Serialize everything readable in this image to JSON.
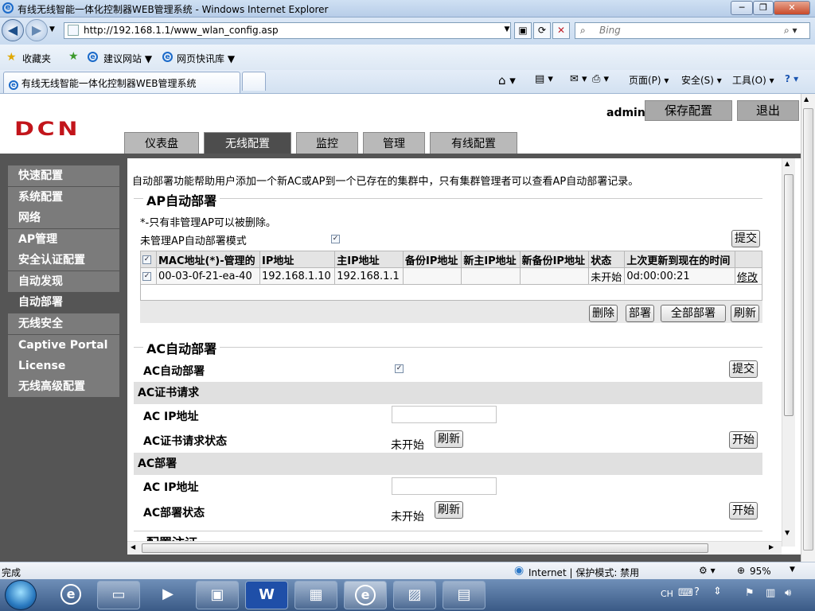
{
  "browser": {
    "window_title": "有线无线智能一体化控制器WEB管理系统 - Windows Internet Explorer",
    "url": "http://192.168.1.1/www_wlan_config.asp",
    "search_placeholder": "Bing",
    "favorites_label": "收藏夹",
    "suggested_sites": "建议网站 ▼",
    "web_slice": "网页快讯库 ▼",
    "tab_title": "有线无线智能一体化控制器WEB管理系统",
    "cmd_page": "页面(P) ▾",
    "cmd_safety": "安全(S) ▾",
    "cmd_tools": "工具(O) ▾",
    "status_text": "完成",
    "zone_text": "Internet | 保护模式: 禁用",
    "zoom": "95%",
    "lang": "CH"
  },
  "header": {
    "logo": "DCN",
    "user": "admin",
    "save_btn": "保存配置",
    "logout_btn": "退出"
  },
  "tabs": [
    "仪表盘",
    "无线配置",
    "监控",
    "管理",
    "有线配置"
  ],
  "sidebar": [
    "快速配置",
    "系统配置",
    "网络",
    "AP管理",
    "安全认证配置",
    "自动发现",
    "自动部署",
    "无线安全",
    "Captive Portal",
    "License",
    "无线高级配置"
  ],
  "content": {
    "intro": "自动部署功能帮助用户添加一个新AC或AP到一个已存在的集群中，只有集群管理者可以查看AP自动部署记录。",
    "ap_section_title": "AP自动部署",
    "note": "*-只有非管理AP可以被删除。",
    "unmanaged_mode_label": "未管理AP自动部署模式",
    "submit": "提交",
    "table_headers": [
      "MAC地址(*)-管理的",
      "IP地址",
      "主IP地址",
      "备份IP地址",
      "新主IP地址",
      "新备份IP地址",
      "状态",
      "上次更新到现在的时间"
    ],
    "table_rows": [
      {
        "mac": "00-03-0f-21-ea-40",
        "ip": "192.168.1.10",
        "primary_ip": "192.168.1.1",
        "backup_ip": "",
        "new_primary_ip": "",
        "new_backup_ip": "",
        "status": "未开始",
        "elapsed": "0d:00:00:21",
        "edit": "修改"
      }
    ],
    "btn_delete": "删除",
    "btn_deploy": "部署",
    "btn_deploy_all": "全部部署",
    "btn_refresh": "刷新",
    "ac_section_title": "AC自动部署",
    "ac_auto_label": "AC自动部署",
    "cert_section": "AC证书请求",
    "ac_ip_label": "AC IP地址",
    "cert_status_label": "AC证书请求状态",
    "not_started": "未开始",
    "btn_start": "开始",
    "deploy_section": "AC部署",
    "deploy_status_label": "AC部署状态",
    "cut_off_title": "配置注证"
  }
}
